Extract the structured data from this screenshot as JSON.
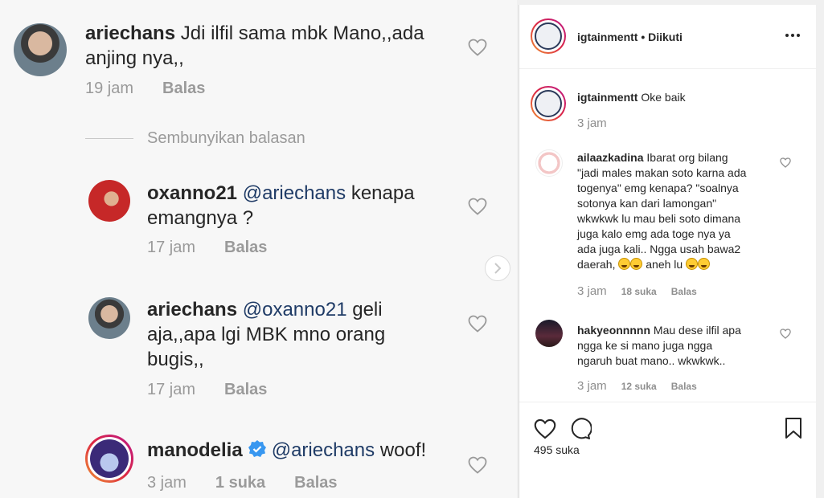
{
  "left_comments": {
    "c1": {
      "username": "ariechans",
      "text": "Jdi ilfil sama mbk Mano,,ada anjing nya,,",
      "time": "19 jam",
      "reply": "Balas"
    },
    "hide_replies": "Sembunyikan balasan",
    "r1": {
      "username": "oxanno21",
      "mention": "@ariechans",
      "text": "kenapa emangnya ?",
      "time": "17 jam",
      "reply": "Balas"
    },
    "r2": {
      "username": "ariechans",
      "mention": "@oxanno21",
      "text": "geli aja,,apa lgi MBK mno orang bugis,,",
      "time": "17 jam",
      "reply": "Balas"
    },
    "r3": {
      "username": "manodelia",
      "mention": "@ariechans",
      "text": "woof!",
      "time": "3 jam",
      "likes": "1 suka",
      "reply": "Balas"
    }
  },
  "right_panel": {
    "header": {
      "username": "igtainmentt",
      "status": "• Diikuti"
    },
    "comments": [
      {
        "username": "igtainmentt",
        "text": "Oke baik",
        "time": "3 jam"
      },
      {
        "username": "ailaazkadina",
        "text_lines": [
          "Ibarat org bilang",
          "\"jadi males makan soto karna ada",
          "togenya\" emg kenapa? \"soalnya",
          "sotonya kan dari lamongan\"",
          "wkwkwk lu mau beli soto dimana",
          "juga kalo emg ada toge nya ya",
          "ada juga kali.. Ngga usah bawa2"
        ],
        "last_line_a": "daerah,",
        "last_line_b": "aneh lu",
        "time": "3 jam",
        "likes": "18 suka",
        "reply": "Balas"
      },
      {
        "username": "hakyeonnnnn",
        "text_lines": [
          "Mau dese ilfil apa",
          "ngga ke si mano juga ngga",
          "ngaruh buat mano.. wkwkwk.."
        ],
        "time": "3 jam",
        "likes": "12 suka",
        "reply": "Balas"
      }
    ],
    "likes_count": "495 suka"
  },
  "colors": {
    "accent_blue": "#3897f0",
    "mention": "#1f3b66",
    "muted": "#8e8e8e"
  }
}
